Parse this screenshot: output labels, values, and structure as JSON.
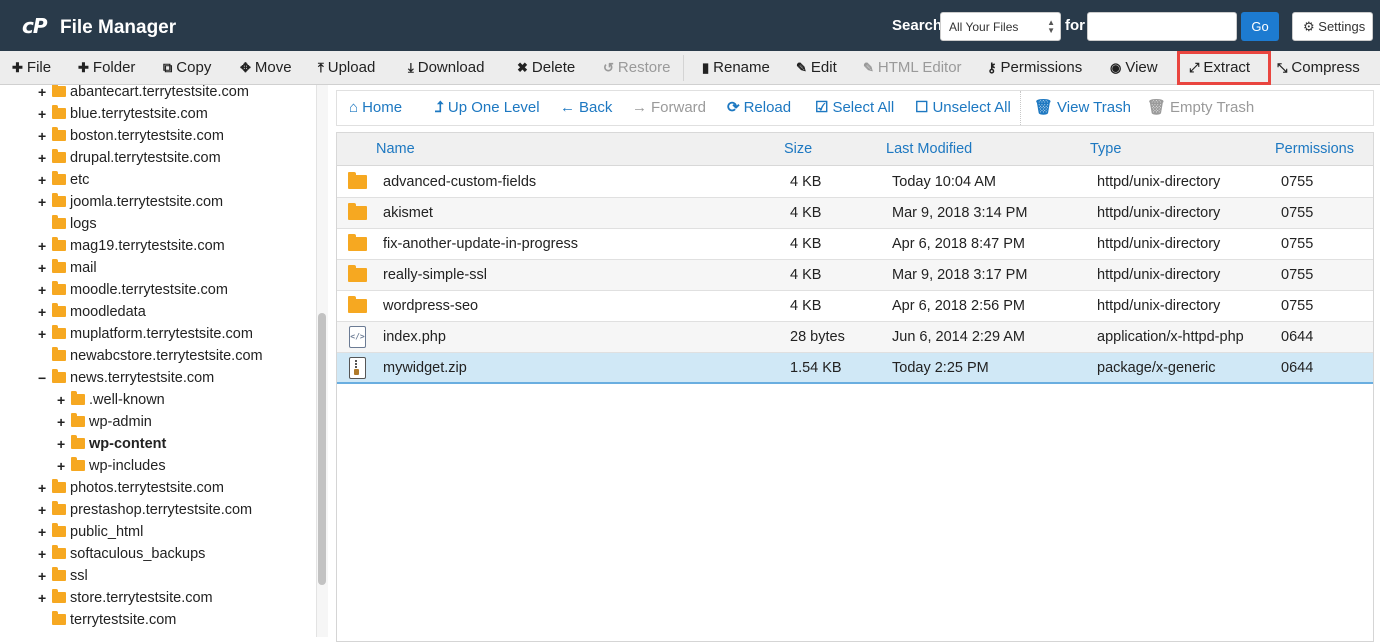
{
  "header": {
    "logo": "cP",
    "title": "File Manager",
    "search_label": "Search",
    "search_scope": "All Your Files",
    "for_label": "for",
    "search_value": "",
    "go_label": "Go",
    "settings_label": "Settings"
  },
  "toolbar": {
    "file": "File",
    "folder": "Folder",
    "copy": "Copy",
    "move": "Move",
    "upload": "Upload",
    "download": "Download",
    "delete": "Delete",
    "restore": "Restore",
    "rename": "Rename",
    "edit": "Edit",
    "html_editor": "HTML Editor",
    "permissions": "Permissions",
    "view": "View",
    "extract": "Extract",
    "compress": "Compress",
    "highlight_color": "#e9453f"
  },
  "tree": {
    "items": [
      {
        "label": "abantecart.terrytestsite.com",
        "toggle": "+"
      },
      {
        "label": "blue.terrytestsite.com",
        "toggle": "+"
      },
      {
        "label": "boston.terrytestsite.com",
        "toggle": "+"
      },
      {
        "label": "drupal.terrytestsite.com",
        "toggle": "+"
      },
      {
        "label": "etc",
        "toggle": "+"
      },
      {
        "label": "joomla.terrytestsite.com",
        "toggle": "+"
      },
      {
        "label": "logs",
        "toggle": ""
      },
      {
        "label": "mag19.terrytestsite.com",
        "toggle": "+"
      },
      {
        "label": "mail",
        "toggle": "+"
      },
      {
        "label": "moodle.terrytestsite.com",
        "toggle": "+"
      },
      {
        "label": "moodledata",
        "toggle": "+"
      },
      {
        "label": "muplatform.terrytestsite.com",
        "toggle": "+"
      },
      {
        "label": "newabcstore.terrytestsite.com",
        "toggle": ""
      },
      {
        "label": "news.terrytestsite.com",
        "toggle": "−"
      },
      {
        "label": ".well-known",
        "toggle": "+"
      },
      {
        "label": "wp-admin",
        "toggle": "+"
      },
      {
        "label": "wp-content",
        "toggle": "+"
      },
      {
        "label": "wp-includes",
        "toggle": "+"
      },
      {
        "label": "photos.terrytestsite.com",
        "toggle": "+"
      },
      {
        "label": "prestashop.terrytestsite.com",
        "toggle": "+"
      },
      {
        "label": "public_html",
        "toggle": "+"
      },
      {
        "label": "softaculous_backups",
        "toggle": "+"
      },
      {
        "label": "ssl",
        "toggle": "+"
      },
      {
        "label": "store.terrytestsite.com",
        "toggle": "+"
      },
      {
        "label": "terrytestsite.com",
        "toggle": ""
      }
    ]
  },
  "nav": {
    "home": "Home",
    "up_one_level": "Up One Level",
    "back": "Back",
    "forward": "Forward",
    "reload": "Reload",
    "select_all": "Select All",
    "unselect_all": "Unselect All",
    "view_trash": "View Trash",
    "empty_trash": "Empty Trash"
  },
  "table": {
    "columns": [
      "Name",
      "Size",
      "Last Modified",
      "Type",
      "Permissions"
    ],
    "rows": [
      {
        "name": "advanced-custom-fields",
        "size": "4 KB",
        "modified": "Today 10:04 AM",
        "type": "httpd/unix-directory",
        "perms": "0755",
        "icon": "folder-icon"
      },
      {
        "name": "akismet",
        "size": "4 KB",
        "modified": "Mar 9, 2018 3:14 PM",
        "type": "httpd/unix-directory",
        "perms": "0755",
        "icon": "folder-icon"
      },
      {
        "name": "fix-another-update-in-progress",
        "size": "4 KB",
        "modified": "Apr 6, 2018 8:47 PM",
        "type": "httpd/unix-directory",
        "perms": "0755",
        "icon": "folder-icon"
      },
      {
        "name": "really-simple-ssl",
        "size": "4 KB",
        "modified": "Mar 9, 2018 3:17 PM",
        "type": "httpd/unix-directory",
        "perms": "0755",
        "icon": "folder-icon"
      },
      {
        "name": "wordpress-seo",
        "size": "4 KB",
        "modified": "Apr 6, 2018 2:56 PM",
        "type": "httpd/unix-directory",
        "perms": "0755",
        "icon": "folder-icon"
      },
      {
        "name": "index.php",
        "size": "28 bytes",
        "modified": "Jun 6, 2014 2:29 AM",
        "type": "application/x-httpd-php",
        "perms": "0644",
        "icon": "php-file-icon"
      },
      {
        "name": "mywidget.zip",
        "size": "1.54 KB",
        "modified": "Today 2:25 PM",
        "type": "package/x-generic",
        "perms": "0644",
        "icon": "zip-file-icon"
      }
    ]
  }
}
